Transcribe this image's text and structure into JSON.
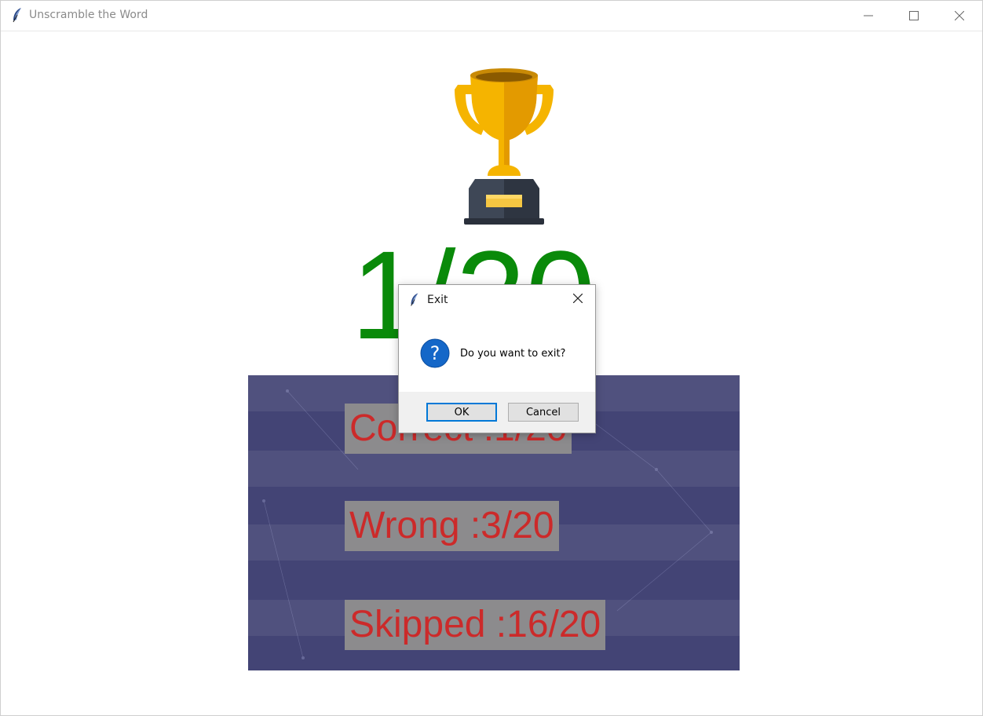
{
  "window": {
    "title": "Unscramble the Word",
    "app_icon": "feather-icon",
    "controls": [
      "minimize-icon",
      "maximize-icon",
      "close-icon"
    ]
  },
  "result": {
    "trophy_icon": "trophy-icon",
    "score": "1/20",
    "score_color": "#0a8a0a"
  },
  "stats": {
    "correct": "Correct :1/20",
    "wrong": "Wrong :3/20",
    "skipped": "Skipped :16/20",
    "text_color": "#cc2a2a"
  },
  "dialog": {
    "title": "Exit",
    "message": "Do you want to exit?",
    "icon": "question-icon",
    "ok_label": "OK",
    "cancel_label": "Cancel"
  }
}
